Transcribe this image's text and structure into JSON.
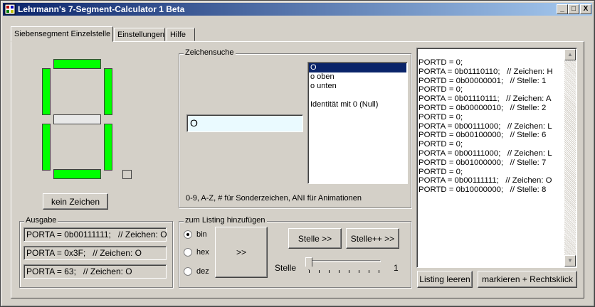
{
  "window": {
    "title": "Lehrmann's 7-Segment-Calculator 1 Beta",
    "controls": {
      "minimize": "_",
      "maximize": "□",
      "close": "X"
    }
  },
  "tabs": [
    {
      "label": "Siebensegment Einzelstelle",
      "active": true
    },
    {
      "label": "Einstellungen",
      "active": false
    },
    {
      "label": "Hilfe",
      "active": false
    }
  ],
  "segments": {
    "a": true,
    "b": true,
    "c": true,
    "d": true,
    "e": true,
    "f": true,
    "g": false,
    "dp": false
  },
  "kein_zeichen_button": "kein Zeichen",
  "ausgabe": {
    "title": "Ausgabe",
    "lines": [
      "PORTA = 0b00111111;   // Zeichen: O",
      "PORTA = 0x3F;   // Zeichen: O",
      "PORTA = 63;   // Zeichen: O"
    ]
  },
  "zeichensuche": {
    "title": "Zeichensuche",
    "input_value": "O",
    "results": [
      "O",
      "o oben",
      "o unten",
      "",
      "Identität mit 0 (Null)"
    ],
    "selected_index": 0,
    "hint": "0-9,  A-Z, # für Sonderzeichen, ANI für Animationen"
  },
  "listing_add": {
    "title": "zum Listing hinzufügen",
    "radios": [
      {
        "label": "bin",
        "checked": true
      },
      {
        "label": "hex",
        "checked": false
      },
      {
        "label": "dez",
        "checked": false
      }
    ],
    "add_button": ">>",
    "stelle_button": "Stelle >>",
    "stelle_pp_button": "Stelle++ >>",
    "slider_label": "Stelle",
    "slider_value": "1"
  },
  "listing": {
    "lines": [
      "PORTD = 0;",
      "PORTA = 0b01110110;   // Zeichen: H",
      "PORTD = 0b00000001;   // Stelle: 1",
      "PORTD = 0;",
      "PORTA = 0b01110111;   // Zeichen: A",
      "PORTD = 0b00000010;   // Stelle: 2",
      "PORTD = 0;",
      "PORTA = 0b00111000;   // Zeichen: L",
      "PORTD = 0b00100000;   // Stelle: 6",
      "PORTD = 0;",
      "PORTA = 0b00111000;   // Zeichen: L",
      "PORTD = 0b01000000;   // Stelle: 7",
      "PORTD = 0;",
      "PORTA = 0b00111111;   // Zeichen: O",
      "PORTD = 0b10000000;   // Stelle: 8"
    ],
    "clear_button": "Listing leeren",
    "mark_button": "markieren + Rechtsklick"
  },
  "colors": {
    "segment_on": "#00ff00",
    "segment_off": "#e8e8e8",
    "title_start": "#0a246a",
    "title_end": "#a6caf0"
  }
}
